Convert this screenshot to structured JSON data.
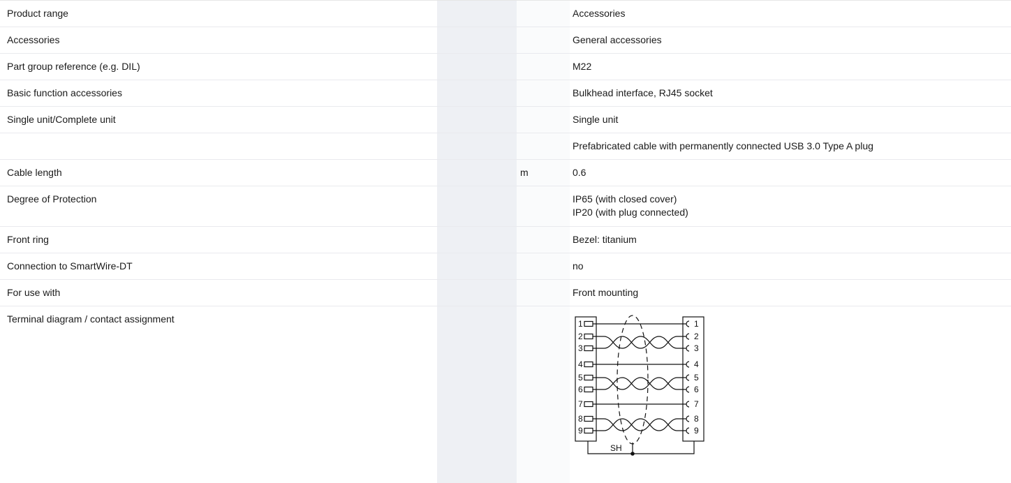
{
  "rows": [
    {
      "label": "Product range",
      "unit": "",
      "value": [
        "Accessories"
      ]
    },
    {
      "label": "Accessories",
      "unit": "",
      "value": [
        "General accessories"
      ]
    },
    {
      "label": "Part group reference (e.g. DIL)",
      "unit": "",
      "value": [
        "M22"
      ]
    },
    {
      "label": "Basic function accessories",
      "unit": "",
      "value": [
        "Bulkhead interface, RJ45 socket"
      ]
    },
    {
      "label": "Single unit/Complete unit",
      "unit": "",
      "value": [
        "Single unit"
      ]
    },
    {
      "label": "",
      "unit": "",
      "value": [
        "Prefabricated cable with permanently connected USB 3.0 Type A plug"
      ]
    },
    {
      "label": "Cable length",
      "unit": "m",
      "value": [
        "0.6"
      ]
    },
    {
      "label": "Degree of Protection",
      "unit": "",
      "value": [
        "IP65 (with closed cover)",
        "IP20 (with plug connected)"
      ]
    },
    {
      "label": "Front ring",
      "unit": "",
      "value": [
        "Bezel: titanium"
      ]
    },
    {
      "label": "Connection to SmartWire-DT",
      "unit": "",
      "value": [
        "no"
      ]
    },
    {
      "label": "For use with",
      "unit": "",
      "value": [
        "Front mounting"
      ]
    },
    {
      "label": "Terminal diagram / contact assignment",
      "unit": ""
    }
  ],
  "diagram": {
    "pins": [
      "1",
      "2",
      "3",
      "4",
      "5",
      "6",
      "7",
      "8",
      "9"
    ],
    "shield_label": "SH"
  }
}
